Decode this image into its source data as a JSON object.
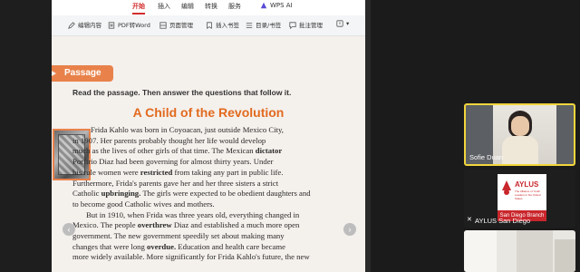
{
  "menu": {
    "items": [
      "开始",
      "插入",
      "编辑",
      "转换",
      "服务",
      "WPS AI"
    ],
    "active_index": 0,
    "accent": "#d22c2c"
  },
  "toolbar": {
    "buttons": [
      "编辑内容",
      "PDF转Word",
      "页面管理",
      "插入书签",
      "目录/书签",
      "批注管理"
    ]
  },
  "document": {
    "section_tag": "Passage",
    "instructions": "Read the passage. Then answer the questions that follow it.",
    "title": "A Child of the Revolution",
    "lines": [
      "Frida Kahlo was born in Coyoacan, just outside Mexico City,",
      "in 1907. Her parents probably thought her life would develop",
      "much as the lives of other girls of that time. The Mexican dictator",
      "Porfirio Diaz had been governing for almost thirty years. Under",
      "his rule women were restricted from taking any part in public life.",
      "Furthermore, Frida's parents gave her and her three sisters a strict",
      "Catholic upbringing. The girls were expected to be obedient daughters and",
      "to become good Catholic wives and mothers.",
      "But in 1910, when Frida was three years old, everything changed in",
      "Mexico. The people overthrew Diaz and established a much more open",
      "government. The new government speedily set about making many",
      "changes that were long overdue. Education and health care became",
      "more widely available. More significantly for Frida Kahlo's future, the new"
    ],
    "bold_words": [
      "dictator",
      "restricted",
      "upbringing.",
      "overthrew",
      "overdue."
    ],
    "title_color": "#e26a1f",
    "tag_color": "#e8824a"
  },
  "participants": [
    {
      "name": "Sofie Duan",
      "active": true,
      "border": "#f2d53c"
    },
    {
      "name": "AYLUS San Diego",
      "logo_text": "AYLUS",
      "logo_subtitle": "The Alliance of Youth Leaders in the United States",
      "branch": "San Diego Branch"
    },
    {
      "name": ""
    }
  ]
}
